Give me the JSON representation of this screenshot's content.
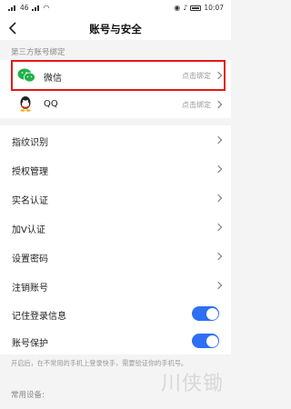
{
  "status_bar": {
    "left_text": "46",
    "right_text": "10:07"
  },
  "nav": {
    "title": "账号与安全"
  },
  "third_party": {
    "header": "第三方账号绑定",
    "items": [
      {
        "name": "微信",
        "action": "点击绑定"
      },
      {
        "name": "QQ",
        "action": "点击绑定"
      }
    ]
  },
  "menu": [
    "指纹识别",
    "授权管理",
    "实名认证",
    "加V认证",
    "设置密码",
    "注销账号"
  ],
  "toggles": [
    {
      "label": "记住登录信息",
      "on": true
    },
    {
      "label": "账号保护",
      "on": true
    }
  ],
  "note": "开启后，在不常用的手机上登录快手，需要验证你的手机号。",
  "devices_header": "常用设备:",
  "watermark": "川侠锄",
  "colors": {
    "accent": "#2f6ff3",
    "highlight": "#e01a1a",
    "wechat": "#22b14c",
    "background": "#f4f4f4"
  }
}
